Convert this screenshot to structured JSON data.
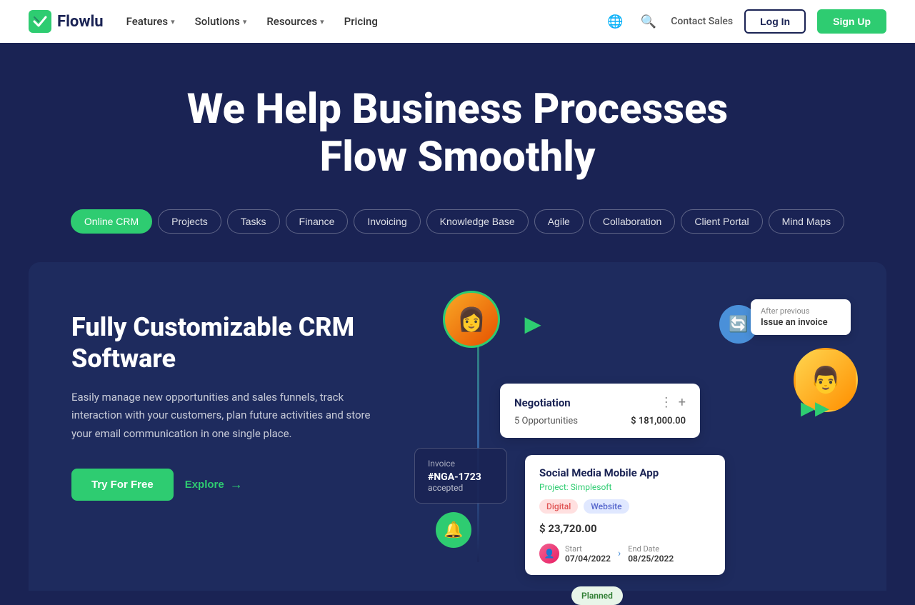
{
  "nav": {
    "logo_text": "Flowlu",
    "links": [
      {
        "label": "Features",
        "has_dropdown": true
      },
      {
        "label": "Solutions",
        "has_dropdown": true
      },
      {
        "label": "Resources",
        "has_dropdown": true
      },
      {
        "label": "Pricing",
        "has_dropdown": false
      }
    ],
    "login_label": "Log In",
    "signup_label": "Sign Up",
    "contact_label": "Contact Sales"
  },
  "hero": {
    "headline_line1": "We Help Business Processes",
    "headline_line2": "Flow Smoothly",
    "tabs": [
      {
        "label": "Online CRM",
        "active": true
      },
      {
        "label": "Projects",
        "active": false
      },
      {
        "label": "Tasks",
        "active": false
      },
      {
        "label": "Finance",
        "active": false
      },
      {
        "label": "Invoicing",
        "active": false
      },
      {
        "label": "Knowledge Base",
        "active": false
      },
      {
        "label": "Agile",
        "active": false
      },
      {
        "label": "Collaboration",
        "active": false
      },
      {
        "label": "Client Portal",
        "active": false
      },
      {
        "label": "Mind Maps",
        "active": false
      }
    ]
  },
  "crm_section": {
    "heading_line1": "Fully Customizable CRM",
    "heading_line2": "Software",
    "description": "Easily manage new opportunities and sales funnels, track interaction with your customers, plan future activities and store your email communication in one single place.",
    "try_btn": "Try For Free",
    "explore_btn": "Explore",
    "after_previous_label": "After previous",
    "after_previous_value": "Issue an invoice",
    "negotiation": {
      "title": "Negotiation",
      "opportunities": "5 Opportunities",
      "amount": "$ 181,000.00"
    },
    "invoice": {
      "label": "Invoice",
      "number": "#NGA-1723",
      "status": "accepted"
    },
    "social_card": {
      "title": "Social Media Mobile App",
      "project": "Project: Simplesoft",
      "tag1": "Digital",
      "tag2": "Website",
      "amount": "$ 23,720.00",
      "start_label": "Start",
      "start_date": "07/04/2022",
      "end_label": "End Date",
      "end_date": "08/25/2022"
    },
    "planned_label": "Planned"
  }
}
